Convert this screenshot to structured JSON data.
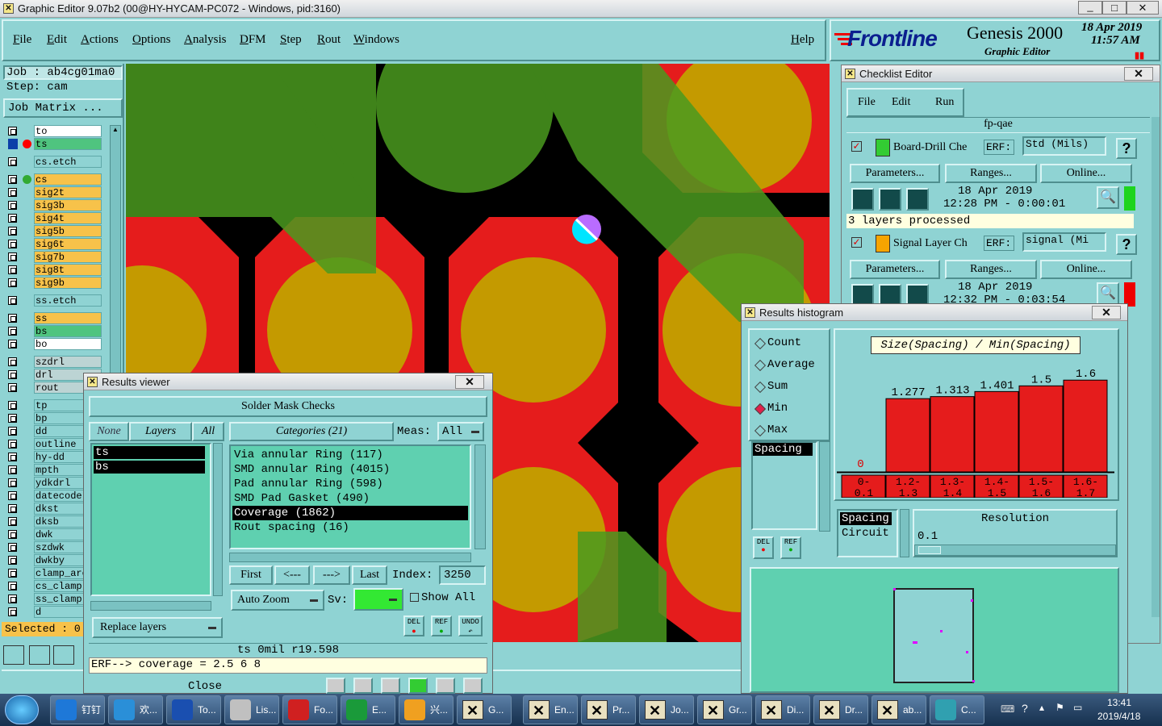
{
  "window": {
    "title": "Graphic Editor 9.07b2 (00@HY-HYCAM-PC072 - Windows, pid:3160)"
  },
  "menubar": {
    "items": [
      "File",
      "Edit",
      "Actions",
      "Options",
      "Analysis",
      "DFM",
      "Step",
      "Rout",
      "Windows"
    ],
    "help": "Help"
  },
  "brand": {
    "logo": "Frontline",
    "product": "Genesis 2000",
    "subtitle": "Graphic Editor",
    "date": "18 Apr 2019",
    "time": "11:57 AM"
  },
  "job": {
    "job": "Job : ab4cg01ma0",
    "step": "Step: cam",
    "matrix": "Job Matrix ..."
  },
  "layers": [
    {
      "name": "to",
      "color": "#ffffff",
      "group": 1
    },
    {
      "name": "ts",
      "color": "#4fc47f",
      "group": 1
    },
    {
      "name": "cs.etch",
      "color": "#8fd3d3",
      "group": 2
    },
    {
      "name": "cs",
      "color": "#f7c24a",
      "group": 3
    },
    {
      "name": "sig2t",
      "color": "#f7c24a",
      "group": 3
    },
    {
      "name": "sig3b",
      "color": "#f7c24a",
      "group": 3
    },
    {
      "name": "sig4t",
      "color": "#f7c24a",
      "group": 3
    },
    {
      "name": "sig5b",
      "color": "#f7c24a",
      "group": 3
    },
    {
      "name": "sig6t",
      "color": "#f7c24a",
      "group": 3
    },
    {
      "name": "sig7b",
      "color": "#f7c24a",
      "group": 3
    },
    {
      "name": "sig8t",
      "color": "#f7c24a",
      "group": 3
    },
    {
      "name": "sig9b",
      "color": "#f7c24a",
      "group": 3
    },
    {
      "name": "ss.etch",
      "color": "#8fd3d3",
      "group": 4
    },
    {
      "name": "ss",
      "color": "#f7c24a",
      "group": 5
    },
    {
      "name": "bs",
      "color": "#4fc47f",
      "group": 5
    },
    {
      "name": "bo",
      "color": "#ffffff",
      "group": 5
    },
    {
      "name": "szdrl",
      "color": "#bcd4d4",
      "group": 6
    },
    {
      "name": "drl",
      "color": "#bcd4d4",
      "group": 6
    },
    {
      "name": "rout",
      "color": "#bcd4d4",
      "group": 6
    },
    {
      "name": "tp",
      "color": "#8fd3d3",
      "group": 7
    },
    {
      "name": "bp",
      "color": "#8fd3d3",
      "group": 7
    },
    {
      "name": "dd",
      "color": "#8fd3d3",
      "group": 7
    },
    {
      "name": "outline",
      "color": "#8fd3d3",
      "group": 7
    },
    {
      "name": "hy-dd",
      "color": "#8fd3d3",
      "group": 7
    },
    {
      "name": "mpth",
      "color": "#8fd3d3",
      "group": 7
    },
    {
      "name": "ydkdrl",
      "color": "#8fd3d3",
      "group": 7
    },
    {
      "name": "datecode-",
      "color": "#8fd3d3",
      "group": 7
    },
    {
      "name": "dkst",
      "color": "#8fd3d3",
      "group": 7
    },
    {
      "name": "dksb",
      "color": "#8fd3d3",
      "group": 7
    },
    {
      "name": "dwk",
      "color": "#8fd3d3",
      "group": 7
    },
    {
      "name": "szdwk",
      "color": "#8fd3d3",
      "group": 7
    },
    {
      "name": "dwkby",
      "color": "#8fd3d3",
      "group": 7
    },
    {
      "name": "clamp_are",
      "color": "#8fd3d3",
      "group": 7
    },
    {
      "name": "cs_clamp",
      "color": "#8fd3d3",
      "group": 7
    },
    {
      "name": "ss_clamp",
      "color": "#8fd3d3",
      "group": 7
    },
    {
      "name": "d",
      "color": "#8fd3d3",
      "group": 7
    }
  ],
  "selected": "Selected : 0",
  "checklist": {
    "title": "Checklist Editor",
    "menu": [
      "File",
      "Edit",
      "Run"
    ],
    "name": "fp-qae",
    "items": [
      {
        "name": "Board-Drill Che",
        "erf_label": "ERF:",
        "erf": "Std (Mils)",
        "params": "Parameters...",
        "ranges": "Ranges...",
        "online": "Online...",
        "date": "18 Apr 2019",
        "time": "12:28 PM - 0:00:01",
        "status": "3 layers processed"
      },
      {
        "name": "Signal Layer Ch",
        "erf_label": "ERF:",
        "erf": "signal (Mi",
        "params": "Parameters...",
        "ranges": "Ranges...",
        "online": "Online...",
        "date": "18 Apr 2019",
        "time": "12:32 PM - 0:03:54"
      }
    ]
  },
  "results_viewer": {
    "title": "Results viewer",
    "header": "Solder Mask Checks",
    "none": "None",
    "layers": "Layers",
    "all": "All",
    "categories_label": "Categories (21)",
    "meas_label": "Meas:",
    "meas": "All",
    "layer_list": [
      "ts",
      "bs"
    ],
    "categories": [
      "Via annular Ring (117)",
      "SMD annular Ring (4015)",
      "Pad annular Ring (598)",
      "SMD Pad Gasket (490)",
      "Coverage (1862)",
      "Rout spacing (16)"
    ],
    "first": "First",
    "prev": "<---",
    "next": "--->",
    "last": "Last",
    "index_label": "Index:",
    "index": "3250",
    "auto_zoom": "Auto Zoom",
    "sv_label": "Sv:",
    "show_all": "Show All",
    "replace": "Replace layers",
    "status": "ts 0mil   r19.598",
    "erf_line": "ERF--> coverage = 2.5 6 8",
    "close": "Close",
    "del": "DEL",
    "ref": "REF",
    "undo": "UNDO"
  },
  "histogram": {
    "title": "Results histogram",
    "modes": [
      "Count",
      "Average",
      "Sum",
      "Min",
      "Max"
    ],
    "selected_mode": "Min",
    "chart_title": "Size(Spacing) / Min(Spacing)",
    "list": [
      "Spacing"
    ],
    "list2": [
      "Spacing",
      "Circuit"
    ],
    "resolution_label": "Resolution",
    "resolution": "0.1",
    "del": "DEL",
    "ref": "REF"
  },
  "chart_data": {
    "type": "bar",
    "title": "Size(Spacing) / Min(Spacing)",
    "categories": [
      "0-0.1",
      "1.2-1.3",
      "1.3-1.4",
      "1.4-1.5",
      "1.5-1.6",
      "1.6-1.7"
    ],
    "values": [
      0,
      1.277,
      1.313,
      1.401,
      1.5,
      1.6
    ],
    "value_labels": [
      "0",
      "1.277",
      "1.313",
      "1.401",
      "1.5",
      "1.6"
    ],
    "ylim": [
      0,
      1.8
    ],
    "grid": false,
    "colors": [
      "#e51c1c"
    ]
  },
  "taskbar": {
    "items": [
      "钉钉",
      "欢...",
      "To...",
      "Lis...",
      "Fo...",
      "E...",
      "兴...",
      "G...",
      "En...",
      "Pr...",
      "Jo...",
      "Gr...",
      "Di...",
      "Dr...",
      "ab...",
      "C..."
    ],
    "time": "13:41",
    "date": "2019/4/18"
  }
}
